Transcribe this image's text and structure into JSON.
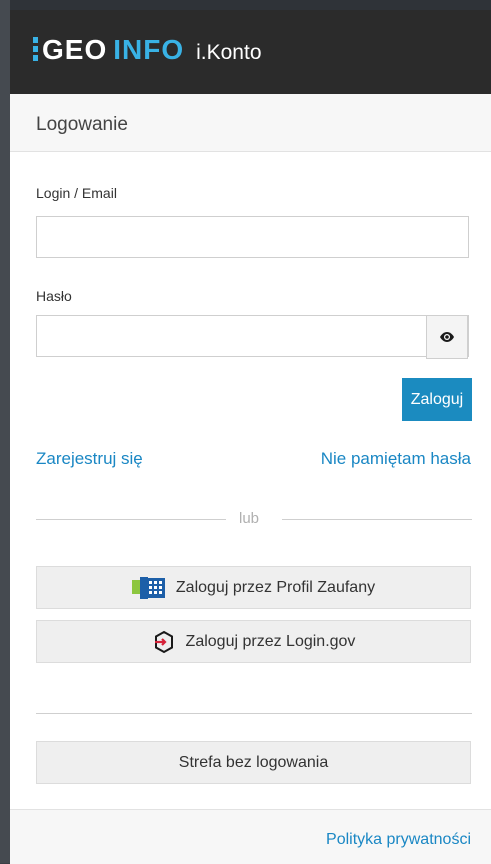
{
  "header": {
    "brand_geo": "GEO",
    "brand_info": "INFO",
    "brand_konto": "i.Konto"
  },
  "form": {
    "title": "Logowanie",
    "login_label": "Login / Email",
    "login_value": "",
    "password_label": "Hasło",
    "password_value": "",
    "show_password_icon": "eye-icon",
    "submit_label": "Zaloguj",
    "register_link": "Zarejestruj się",
    "forgot_link": "Nie pamiętam hasła",
    "separator": "lub"
  },
  "alternatives": {
    "profil_zaufany": "Zaloguj przez Profil Zaufany",
    "login_gov": "Zaloguj przez Login.gov",
    "guest_zone": "Strefa bez logowania"
  },
  "footer": {
    "privacy_link": "Polityka prywatności"
  },
  "colors": {
    "accent": "#1b8bc0",
    "brand_blue": "#39b2e5",
    "header_bg": "#2b2b2b",
    "logingov_red": "#d6233a"
  }
}
